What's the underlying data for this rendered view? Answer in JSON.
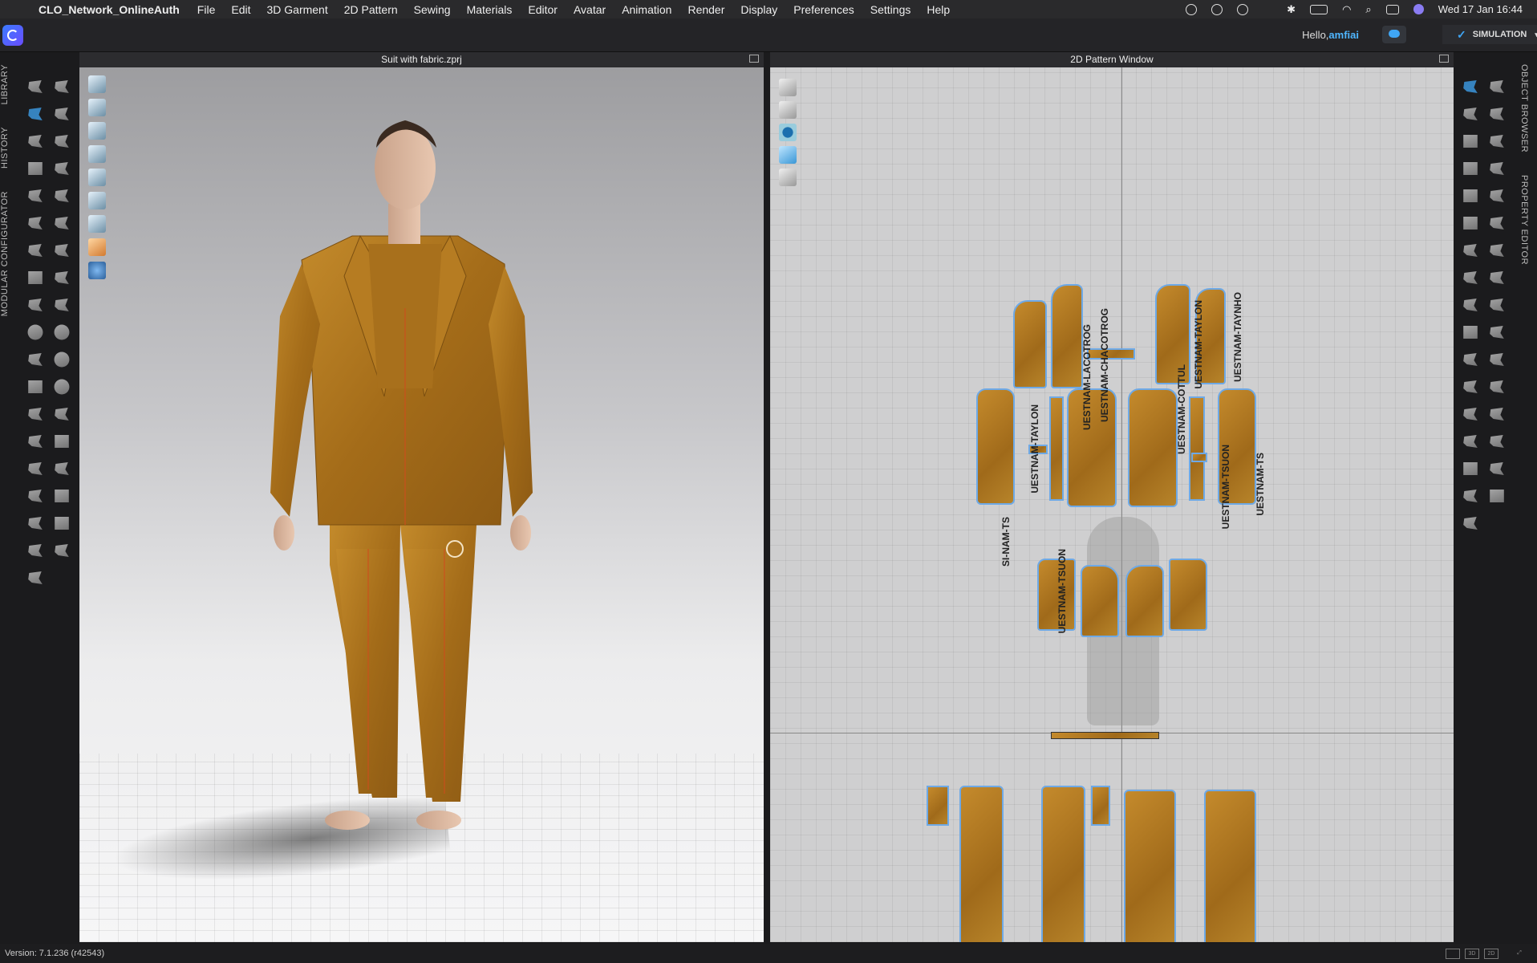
{
  "menubar": {
    "app_name": "CLO_Network_OnlineAuth",
    "items": [
      "File",
      "Edit",
      "3D Garment",
      "2D Pattern",
      "Sewing",
      "Materials",
      "Editor",
      "Avatar",
      "Animation",
      "Render",
      "Display",
      "Preferences",
      "Settings",
      "Help"
    ],
    "clock": "Wed 17 Jan  16:44"
  },
  "header": {
    "greeting": "Hello,",
    "username": "amfiai",
    "simulation_label": "SIMULATION"
  },
  "left_tabs": [
    "LIBRARY",
    "HISTORY",
    "MODULAR CONFIGURATOR"
  ],
  "right_tabs": [
    "OBJECT BROWSER",
    "PROPERTY EDITOR"
  ],
  "viewport3d": {
    "title": "Suit with fabric.zprj"
  },
  "viewport2d": {
    "title": "2D Pattern Window",
    "labels": [
      "UESTNAM-LACOTROG",
      "UESTNAM-CHACOTROG",
      "UESTNAM-TAYLON",
      "UESTNAM-TAYNHO",
      "UESTNAM-TAYLON",
      "UESTNAM-COTTUL",
      "UESTNAM-TSUON",
      "UESTNAM-TS",
      "UESTNAM-TSUON",
      "SI-NAM-TS"
    ]
  },
  "status": {
    "version": "Version: 7.1.236 (r42543)"
  },
  "colors": {
    "accent": "#3fa6f5",
    "fabric": "#b07a22",
    "seam": "#6ea9e6"
  }
}
